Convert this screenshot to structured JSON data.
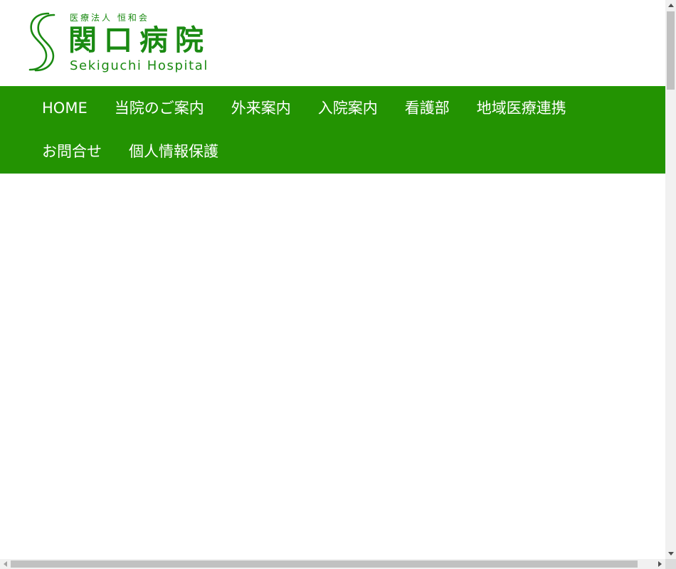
{
  "header": {
    "logo": {
      "subtitle": "医療法人 恒和会",
      "name": "関口病院",
      "english": "Sekiguchi Hospital",
      "icon": "hospital-s-logo-icon"
    }
  },
  "nav": {
    "items": [
      {
        "label": "HOME"
      },
      {
        "label": "当院のご案内"
      },
      {
        "label": "外来案内"
      },
      {
        "label": "入院案内"
      },
      {
        "label": "看護部"
      },
      {
        "label": "地域医療連携"
      },
      {
        "label": "お問合せ"
      },
      {
        "label": "個人情報保護"
      }
    ]
  },
  "colors": {
    "brand_green": "#1a8a12",
    "nav_background": "#239302",
    "nav_text": "#ffffff"
  }
}
